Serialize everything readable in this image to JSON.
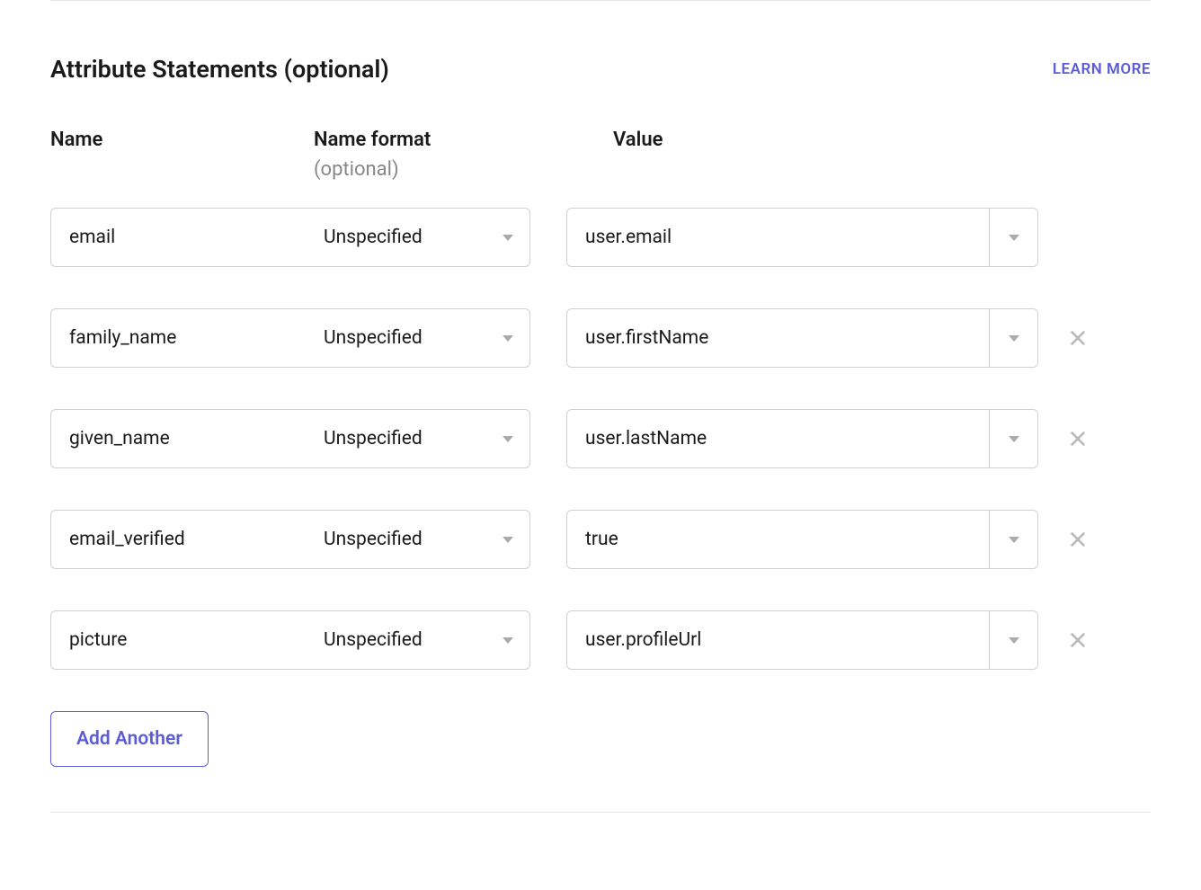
{
  "section": {
    "title": "Attribute Statements (optional)",
    "learn_more": "LEARN MORE"
  },
  "headers": {
    "name": "Name",
    "format": "Name format",
    "format_sublabel": "(optional)",
    "value": "Value"
  },
  "rows": [
    {
      "name": "email",
      "format": "Unspecified",
      "value": "user.email",
      "removable": false
    },
    {
      "name": "family_name",
      "format": "Unspecified",
      "value": "user.firstName",
      "removable": true
    },
    {
      "name": "given_name",
      "format": "Unspecified",
      "value": "user.lastName",
      "removable": true
    },
    {
      "name": "email_verified",
      "format": "Unspecified",
      "value": "true",
      "removable": true
    },
    {
      "name": "picture",
      "format": "Unspecified",
      "value": "user.profileUrl",
      "removable": true
    }
  ],
  "actions": {
    "add_another": "Add Another"
  }
}
